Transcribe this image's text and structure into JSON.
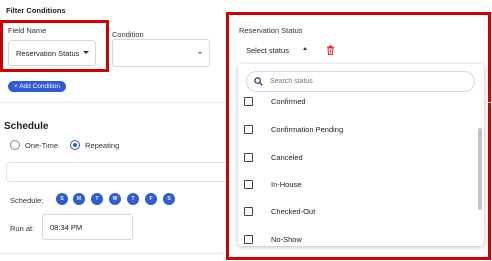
{
  "filter": {
    "title": "Filter Conditions",
    "field_label": "Field Name",
    "field_value": "Reservation Status",
    "condition_label": "Condition",
    "add_button": "+ Add Condition"
  },
  "status": {
    "label": "Reservation Status",
    "select_placeholder": "Select status",
    "search_placeholder": "Search status",
    "options": [
      "Confirmed",
      "Confirmation Pending",
      "Canceled",
      "In-House",
      "Checked-Out",
      "No-Show"
    ]
  },
  "schedule": {
    "title": "Schedule",
    "one_time": "One-Time",
    "repeating": "Repeating",
    "days_label": "Schedule:",
    "days": [
      "S",
      "M",
      "T",
      "W",
      "T",
      "F",
      "S"
    ],
    "run_at_label": "Run at:",
    "run_at_value": "08:34 PM"
  },
  "colors": {
    "accent": "#2f5bd6",
    "highlight": "#d40000",
    "delete": "#e03030"
  }
}
